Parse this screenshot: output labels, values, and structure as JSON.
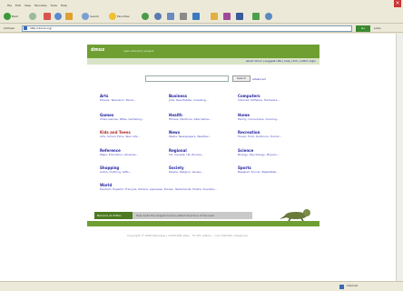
{
  "browser": {
    "menu": [
      "File",
      "Edit",
      "View",
      "Favorites",
      "Tools",
      "Help"
    ],
    "toolbar": {
      "back_label": "Back",
      "search_label": "Search",
      "favorites_label": "Favorites"
    },
    "address": {
      "label": "Address",
      "value": "http://dmoz.org/",
      "go_label": "Go",
      "links_label": "Links"
    },
    "status": {
      "zone": "Internet"
    }
  },
  "page": {
    "logo": "dmoz",
    "tagline": "open directory project",
    "topnav": "about dmoz | suggest URL | help | link | editor login",
    "search": {
      "button": "Search",
      "advanced": "advanced"
    },
    "categories": [
      {
        "title": "Arts",
        "sub": "Movies, Television, Music..."
      },
      {
        "title": "Business",
        "sub": "Jobs, Real Estate, Investing..."
      },
      {
        "title": "Computers",
        "sub": "Internet, Software, Hardware..."
      },
      {
        "title": "Games",
        "sub": "Video Games, RPGs, Gambling..."
      },
      {
        "title": "Health",
        "sub": "Fitness, Medicine, Alternative..."
      },
      {
        "title": "Home",
        "sub": "Family, Consumers, Cooking..."
      },
      {
        "title": "Kids and Teens",
        "sub": "Arts, School Time, Teen Life..."
      },
      {
        "title": "News",
        "sub": "Media, Newspapers, Weather..."
      },
      {
        "title": "Recreation",
        "sub": "Travel, Food, Outdoors, Humor..."
      },
      {
        "title": "Reference",
        "sub": "Maps, Education, Libraries..."
      },
      {
        "title": "Regional",
        "sub": "US, Canada, UK, Europe..."
      },
      {
        "title": "Science",
        "sub": "Biology, Psychology, Physics..."
      },
      {
        "title": "Shopping",
        "sub": "Autos, Clothing, Gifts..."
      },
      {
        "title": "Society",
        "sub": "People, Religion, Issues..."
      },
      {
        "title": "Sports",
        "sub": "Baseball, Soccer, Basketball..."
      },
      {
        "title": "World",
        "sub": "Deutsch, Español, Français, Italiano, Japanese, Korean, Nederlands, Polska, Svenska..."
      }
    ],
    "footer_tab": "Become an Editor",
    "footer_bar": "Help build the largest human-edited directory of the web",
    "copyright": "Copyright © 2006 Netscape   |   4,830,584 sites - 75,151 editors - over 590,000 categories"
  },
  "colors": {
    "brand_green": "#6f9f32",
    "link_blue": "#1f1fa0"
  }
}
